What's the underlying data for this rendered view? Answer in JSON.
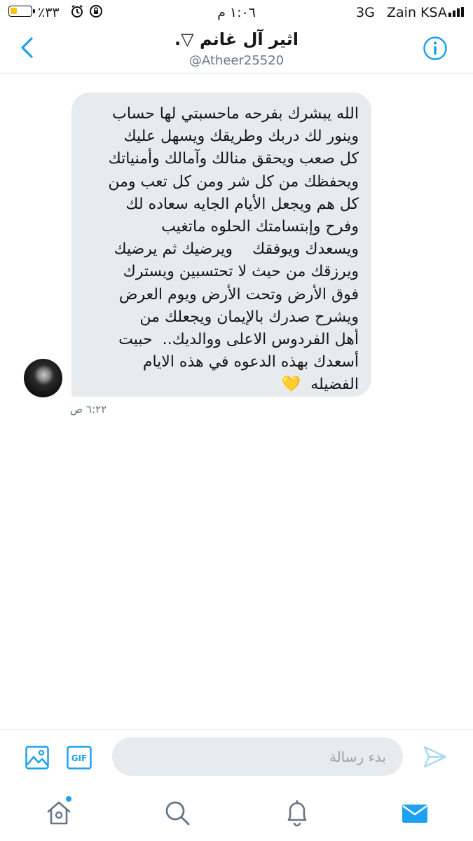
{
  "status_bar": {
    "battery": "٪٣٣",
    "time": "١:٠٦ م",
    "network": "3G",
    "carrier": "Zain KSA"
  },
  "header": {
    "title": "اثير آل غانم ▽.",
    "handle": "@Atheer25520"
  },
  "conversation": {
    "message_lines": [
      "الله يبشرك بفرحه ماحسبتي لها حساب",
      "وينور لك دربك وطريقك ويسهل عليك",
      "كل صعب ويحقق منالك وآمالك وأمنياتك",
      "ويحفظك من كل شر ومن كل تعب ومن",
      "كل هم ويجعل الأيام الجايه سعاده لك",
      "وفرح وإبتسامتك الحلوه ماتغيب",
      "ويسعدك ويوفقك    ويرضيك ثم يرضيك",
      "ويرزقك من حيث لا تحتسبين ويسترك",
      "فوق الأرض وتحت الأرض ويوم العرض",
      "ويشرح صدرك بالإيمان ويجعلك من",
      "أهل الفردوس الاعلى ووالديك..  حبيت",
      "أسعدك بهذه الدعوه في هذه الايام",
      "الفضيله  💛"
    ],
    "timestamp": "٦:٢٢ ص"
  },
  "composer": {
    "placeholder": "بدء رسالة",
    "gif_label": "GIF"
  },
  "icons": {
    "back": "chevron-left-icon",
    "info": "info-icon",
    "image": "image-icon",
    "gif": "gif-icon",
    "send": "send-icon",
    "home": "home-icon",
    "search": "search-icon",
    "notifications": "bell-icon",
    "messages": "mail-icon"
  },
  "colors": {
    "accent": "#1da1f2",
    "bubble": "#e8ebee",
    "muted": "#657786"
  }
}
